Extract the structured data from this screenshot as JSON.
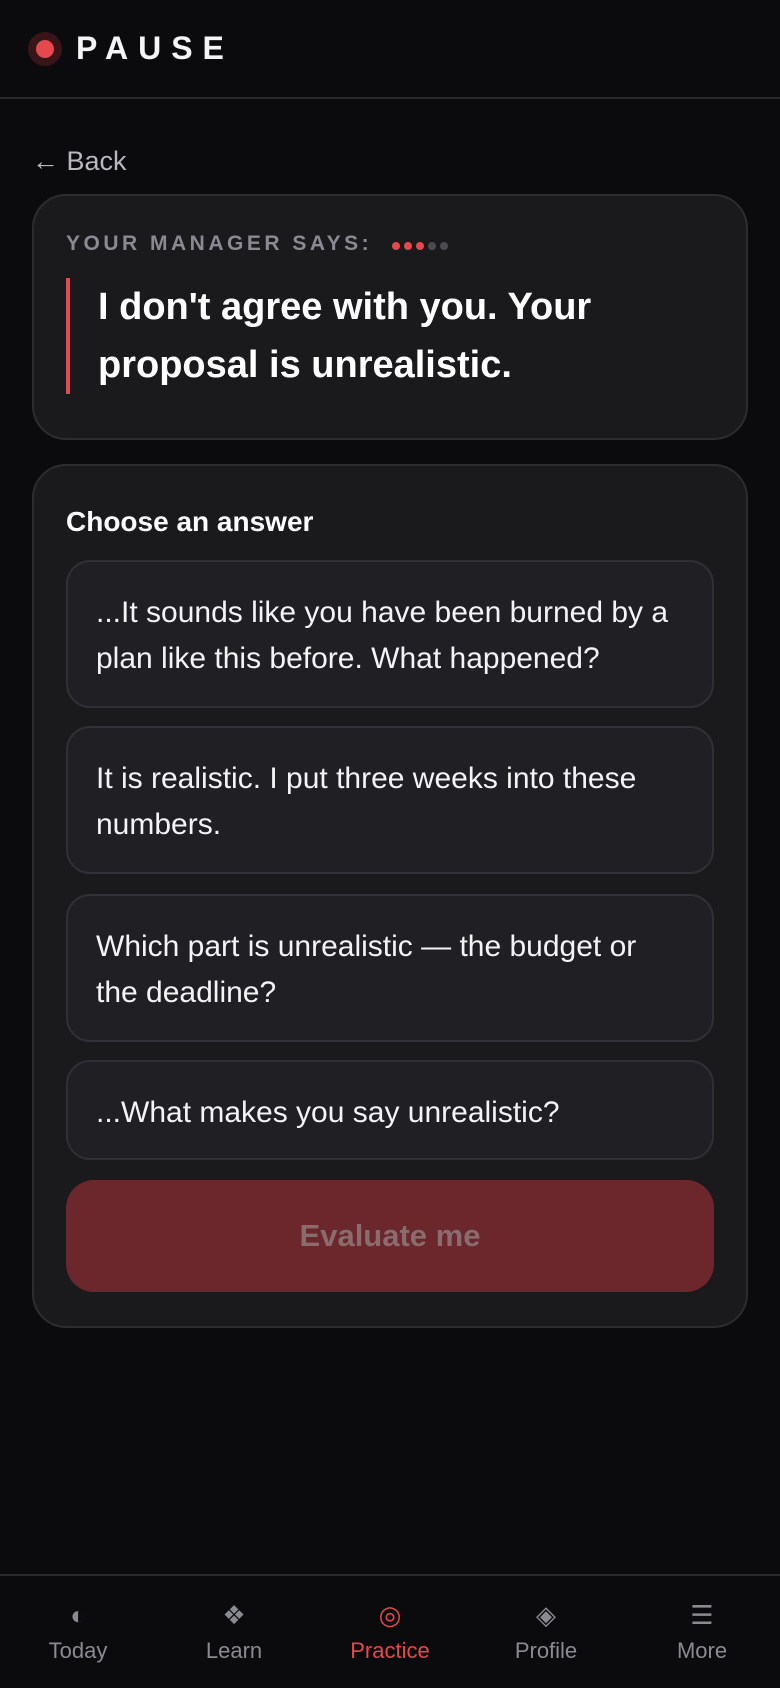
{
  "app": {
    "name": "PAUSE",
    "accent": "#e5484d"
  },
  "nav_back": {
    "label": "← Back"
  },
  "prompt": {
    "label": "YOUR MANAGER SAYS:",
    "progress": {
      "completed": 3,
      "total": 5
    },
    "quote": "I don't agree with you. Your proposal is unrealistic."
  },
  "answers": {
    "title": "Choose an answer",
    "options": [
      "...It sounds like you have been burned by a plan like this before. What happened?",
      "It is realistic. I put three weeks into these numbers.",
      "Which part is unrealistic — the budget or the deadline?",
      "...What makes you say unrealistic?"
    ],
    "submit_label": "Evaluate me"
  },
  "bottom_nav": {
    "items": [
      {
        "label": "Today",
        "icon": "half-circle-icon",
        "glyph": "◐"
      },
      {
        "label": "Learn",
        "icon": "diamond-cluster-icon",
        "glyph": "❖"
      },
      {
        "label": "Practice",
        "icon": "target-icon",
        "glyph": "◎"
      },
      {
        "label": "Profile",
        "icon": "diamond-icon",
        "glyph": "◈"
      },
      {
        "label": "More",
        "icon": "menu-icon",
        "glyph": "☰"
      }
    ],
    "active": "Practice"
  }
}
